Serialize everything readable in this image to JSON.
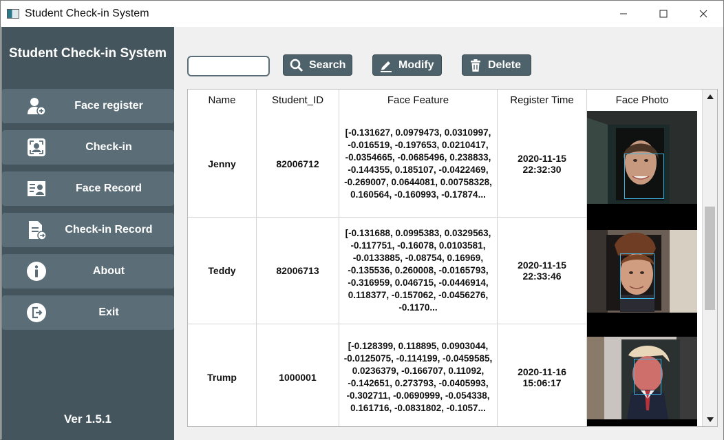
{
  "window": {
    "title": "Student Check-in System",
    "controls": [
      "minimize",
      "maximize",
      "close"
    ]
  },
  "sidebar": {
    "title": "Student Check-in System",
    "items": [
      {
        "label": "Face register",
        "icon": "user-add-icon"
      },
      {
        "label": "Check-in",
        "icon": "face-scan-icon"
      },
      {
        "label": "Face Record",
        "icon": "id-card-icon"
      },
      {
        "label": "Check-in Record",
        "icon": "document-icon"
      },
      {
        "label": "About",
        "icon": "info-icon"
      },
      {
        "label": "Exit",
        "icon": "exit-icon"
      }
    ],
    "version": "Ver 1.5.1"
  },
  "toolbar": {
    "search_value": "",
    "search_label": "Search",
    "modify_label": "Modify",
    "delete_label": "Delete"
  },
  "table": {
    "columns": [
      "Name",
      "Student_ID",
      "Face Feature",
      "Register Time",
      "Face Photo"
    ],
    "rows": [
      {
        "name": "Jenny",
        "student_id": "82006712",
        "feature": "[-0.131627, 0.0979473, 0.0310997, -0.016519, -0.197653, 0.0210417, -0.0354665, -0.0685496, 0.238833, -0.144355, 0.185107, -0.0422469, -0.269007, 0.0644081, 0.00758328, 0.160564, -0.160993, -0.17874...",
        "register_time": "2020-11-15\n22:32:30"
      },
      {
        "name": "Teddy",
        "student_id": "82006713",
        "feature": "[-0.131688, 0.0995383, 0.0329563, -0.117751, -0.16078, 0.0103581, -0.0133885, -0.08754, 0.16969, -0.135536, 0.260008, -0.0165793, -0.316959, 0.046715, -0.0446914, 0.118377, -0.157062, -0.0456276, -0.1170...",
        "register_time": "2020-11-15\n22:33:46"
      },
      {
        "name": "Trump",
        "student_id": "1000001",
        "feature": "[-0.128399, 0.118895, 0.0903044, -0.0125075, -0.114199, -0.0459585, 0.0236379, -0.166707, 0.11092, -0.142651, 0.273793, -0.0405993, -0.302711, -0.0690999, -0.054338, 0.161716, -0.0831802, -0.1057...",
        "register_time": "2020-11-16\n15:06:17"
      }
    ]
  },
  "colors": {
    "sidebar_bg": "#44555d",
    "nav_item_bg": "#5b6e77",
    "button_bg": "#4e626b",
    "face_box": "#3fb7e6"
  }
}
